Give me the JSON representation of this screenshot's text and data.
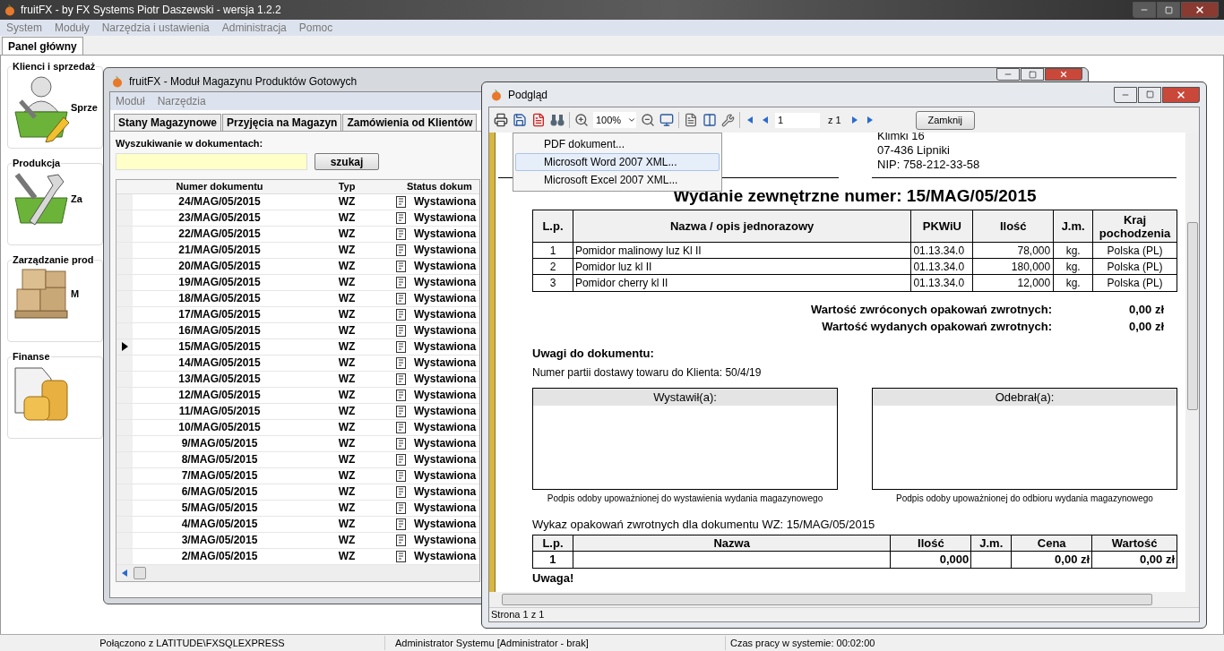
{
  "main_window": {
    "title": "fruitFX - by FX Systems Piotr Daszewski - wersja 1.2.2",
    "menu": [
      "System",
      "Moduły",
      "Narzędzia i ustawienia",
      "Administracja",
      "Pomoc"
    ],
    "tabs": [
      {
        "label": "Panel główny",
        "selected": true
      }
    ],
    "groups": [
      {
        "title": "Klienci i sprzedaż",
        "label": "Sprze",
        "kind": "sales"
      },
      {
        "title": "Produkcja",
        "label": "Za",
        "kind": "production"
      },
      {
        "title": "Zarządzanie prod",
        "label": "M",
        "kind": "storage"
      },
      {
        "title": "Finanse",
        "kind": "finance"
      }
    ],
    "status_bar": [
      "Połączono z LATITUDE\\FXSQLEXPRESS",
      "Administrator Systemu [Administrator - brak]",
      "Czas pracy w systemie: 00:02:00"
    ]
  },
  "module_window": {
    "title": "fruitFX - Moduł Magazynu Produktów Gotowych",
    "menu": [
      "Moduł",
      "Narzędzia"
    ],
    "tabs": [
      {
        "label": "Stany Magazynowe",
        "selected": false
      },
      {
        "label": "Przyjęcia na Magazyn",
        "selected": false
      },
      {
        "label": "Zamówienia od Klientów",
        "selected": false
      }
    ],
    "search": {
      "label": "Wyszukiwanie w dokumentach:",
      "button": "szukaj"
    },
    "table": {
      "columns": [
        "Numer dokumentu",
        "Typ",
        "Status dokum"
      ],
      "rows": [
        {
          "number": "24/MAG/05/2015",
          "type": "WZ",
          "status": "Wystawiona",
          "selected": false
        },
        {
          "number": "23/MAG/05/2015",
          "type": "WZ",
          "status": "Wystawiona",
          "selected": false
        },
        {
          "number": "22/MAG/05/2015",
          "type": "WZ",
          "status": "Wystawiona",
          "selected": false
        },
        {
          "number": "21/MAG/05/2015",
          "type": "WZ",
          "status": "Wystawiona",
          "selected": false
        },
        {
          "number": "20/MAG/05/2015",
          "type": "WZ",
          "status": "Wystawiona",
          "selected": false
        },
        {
          "number": "19/MAG/05/2015",
          "type": "WZ",
          "status": "Wystawiona",
          "selected": false
        },
        {
          "number": "18/MAG/05/2015",
          "type": "WZ",
          "status": "Wystawiona",
          "selected": false
        },
        {
          "number": "17/MAG/05/2015",
          "type": "WZ",
          "status": "Wystawiona",
          "selected": false
        },
        {
          "number": "16/MAG/05/2015",
          "type": "WZ",
          "status": "Wystawiona",
          "selected": false
        },
        {
          "number": "15/MAG/05/2015",
          "type": "WZ",
          "status": "Wystawiona",
          "selected": true
        },
        {
          "number": "14/MAG/05/2015",
          "type": "WZ",
          "status": "Wystawiona",
          "selected": false
        },
        {
          "number": "13/MAG/05/2015",
          "type": "WZ",
          "status": "Wystawiona",
          "selected": false
        },
        {
          "number": "12/MAG/05/2015",
          "type": "WZ",
          "status": "Wystawiona",
          "selected": false
        },
        {
          "number": "11/MAG/05/2015",
          "type": "WZ",
          "status": "Wystawiona",
          "selected": false
        },
        {
          "number": "10/MAG/05/2015",
          "type": "WZ",
          "status": "Wystawiona",
          "selected": false
        },
        {
          "number": "9/MAG/05/2015",
          "type": "WZ",
          "status": "Wystawiona",
          "selected": false
        },
        {
          "number": "8/MAG/05/2015",
          "type": "WZ",
          "status": "Wystawiona",
          "selected": false
        },
        {
          "number": "7/MAG/05/2015",
          "type": "WZ",
          "status": "Wystawiona",
          "selected": false
        },
        {
          "number": "6/MAG/05/2015",
          "type": "WZ",
          "status": "Wystawiona",
          "selected": false
        },
        {
          "number": "5/MAG/05/2015",
          "type": "WZ",
          "status": "Wystawiona",
          "selected": false
        },
        {
          "number": "4/MAG/05/2015",
          "type": "WZ",
          "status": "Wystawiona",
          "selected": false
        },
        {
          "number": "3/MAG/05/2015",
          "type": "WZ",
          "status": "Wystawiona",
          "selected": false
        },
        {
          "number": "2/MAG/05/2015",
          "type": "WZ",
          "status": "Wystawiona",
          "selected": false
        }
      ]
    }
  },
  "preview_window": {
    "title": "Podgląd",
    "toolbar": {
      "zoom": "100%",
      "page": "1",
      "page_count": "z 1",
      "close_button": "Zamknij"
    },
    "export_menu": [
      {
        "label": "PDF dokument...",
        "selected": false
      },
      {
        "label": "Microsoft Word 2007 XML...",
        "selected": true
      },
      {
        "label": "Microsoft Excel 2007 XML...",
        "selected": false
      }
    ],
    "document": {
      "address_lines": [
        "Klimki 16",
        "07-436 Lipniki",
        "NIP: 758-212-33-58"
      ],
      "title": "Wydanie zewnętrzne numer: 15/MAG/05/2015",
      "items_table": {
        "columns": [
          "L.p.",
          "Nazwa / opis jednorazowy",
          "PKWiU",
          "Ilość",
          "J.m.",
          "Kraj pochodzenia"
        ],
        "rows": [
          [
            "1",
            "Pomidor malinowy luz Kl II",
            "01.13.34.0",
            "78,000",
            "kg.",
            "Polska (PL)"
          ],
          [
            "2",
            "Pomidor luz kl II",
            "01.13.34.0",
            "180,000",
            "kg.",
            "Polska (PL)"
          ],
          [
            "3",
            "Pomidor cherry kl II",
            "01.13.34.0",
            "12,000",
            "kg.",
            "Polska (PL)"
          ]
        ]
      },
      "totals": [
        {
          "label": "Wartość zwróconych opakowań zwrotnych:",
          "value": "0,00 zł"
        },
        {
          "label": "Wartość wydanych opakowań zwrotnych:",
          "value": "0,00 zł"
        }
      ],
      "notes_title": "Uwagi do dokumentu:",
      "notes": "Numer partii dostawy towaru do Klienta: 50/4/19",
      "signatures": [
        {
          "title": "Wystawił(a):",
          "caption": "Podpis odoby upoważnionej do wystawienia wydania magazynowego"
        },
        {
          "title": "Odebrał(a):",
          "caption": "Podpis odoby upoważnionej do odbioru wydania magazynowego"
        }
      ],
      "packaging_title": "Wykaz opakowań zwrotnych dla dokumentu WZ: 15/MAG/05/2015",
      "packaging_table": {
        "columns": [
          "L.p.",
          "Nazwa",
          "Ilość",
          "J.m.",
          "Cena",
          "Wartość"
        ],
        "rows": [
          {
            "lp": "1",
            "quantity": "0,000",
            "price": "0,00 zł",
            "value": "0,00 zł"
          }
        ]
      },
      "warning": "Uwaga!"
    },
    "status": "Strona 1 z 1"
  }
}
